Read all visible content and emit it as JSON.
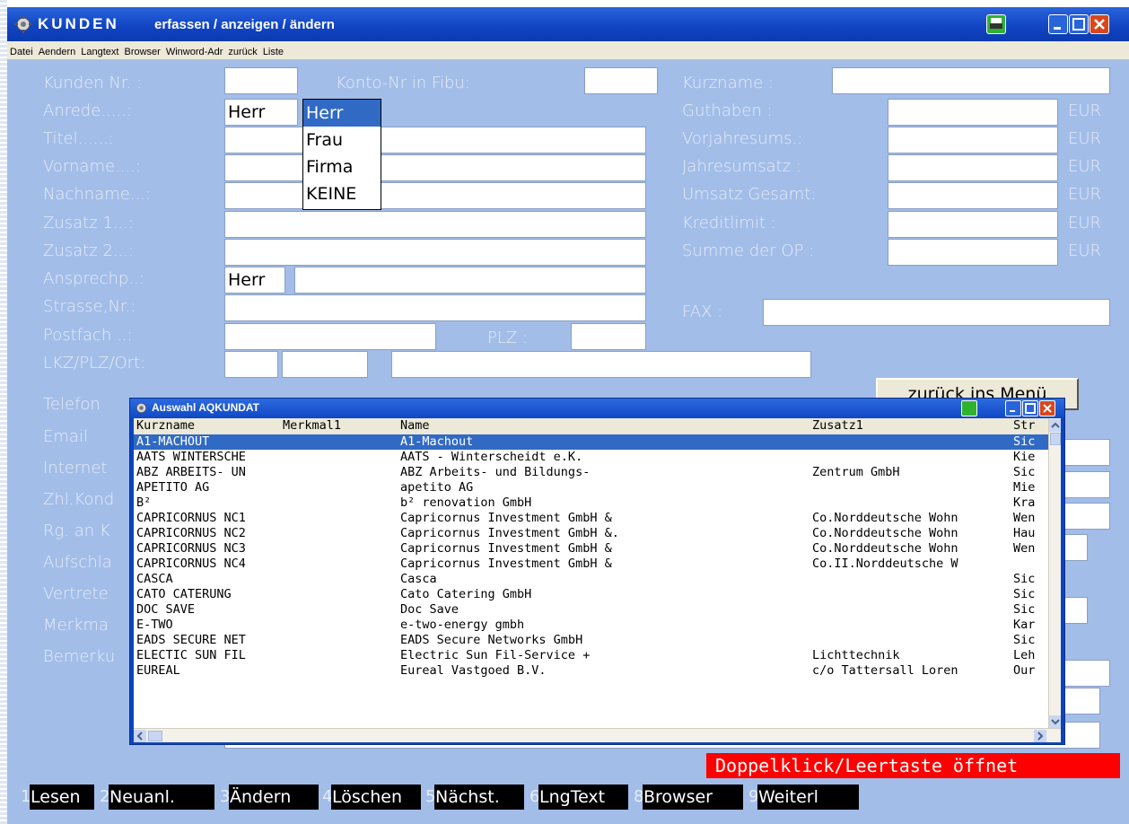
{
  "window": {
    "title": "KUNDEN",
    "subtitle": "erfassen / anzeigen / ändern"
  },
  "menu": [
    "Datei",
    "Aendern",
    "Langtext",
    "Browser",
    "Winword-Adr",
    "zurück",
    "Liste"
  ],
  "form": {
    "kunden_nr": "Kunden Nr. :",
    "konto_nr": "Konto-Nr in Fibu:",
    "kurzname": "Kurzname :",
    "anrede": "Anrede.....:",
    "anrede_value": "Herr",
    "titel": "Titel......:",
    "vorname": "Vorname....:",
    "nachname": "Nachname...:",
    "zusatz1": "Zusatz 1...:",
    "zusatz2": "Zusatz 2...:",
    "ansprechp": "Ansprechp..:",
    "ansprechp_value": "Herr",
    "strasse": "Strasse,Nr.:",
    "postfach": "Postfach ..:",
    "plz": "PLZ :",
    "lkz": "LKZ/PLZ/Ort:",
    "telefon": "Telefon",
    "email": "Email",
    "internet": "Internet",
    "zhl": "Zhl.Kond",
    "rg": "Rg. an K",
    "aufschlag": "Aufschla",
    "vertreter": "Vertrete",
    "merkmal": "Merkma",
    "bemerkung": "Bemerku",
    "guthaben": "Guthaben     :",
    "vorjahr": "Vorjahresums.:",
    "jahresumsatz": "Jahresumsatz :",
    "umsatz_gesamt": "Umsatz Gesamt:",
    "kreditlimit": "Kreditlimit  :",
    "summe_op": "Summe der OP :",
    "fax": "FAX :",
    "currency": "EUR"
  },
  "anrede_options": [
    "Herr",
    "Frau",
    "Firma",
    "KEINE"
  ],
  "back_button": "zurück ins Menü",
  "status_text": "Doppelklick/Leertaste öffnet",
  "function_keys": [
    {
      "num": "1",
      "label": "Lesen"
    },
    {
      "num": "2",
      "label": "Neuanl."
    },
    {
      "num": "3",
      "label": "Ändern"
    },
    {
      "num": "4",
      "label": "Löschen"
    },
    {
      "num": "5",
      "label": "Nächst."
    },
    {
      "num": "6",
      "label": "LngText"
    },
    {
      "num": "8",
      "label": "Browser"
    },
    {
      "num": "9",
      "label": "Weiterl"
    }
  ],
  "popup": {
    "title": "Auswahl AQKUNDAT",
    "columns": [
      "Kurzname",
      "Merkmal1",
      "Name",
      "Zusatz1",
      "Str"
    ],
    "rows": [
      [
        "A1-MACHOUT",
        "",
        "A1-Machout",
        "",
        "Sic"
      ],
      [
        "AATS WINTERSCHE",
        "",
        "AATS - Winterscheidt e.K.",
        "",
        "Kie"
      ],
      [
        "ABZ ARBEITS- UN",
        "",
        "ABZ Arbeits- und Bildungs-",
        "Zentrum GmbH",
        "Sic"
      ],
      [
        "APETITO AG",
        "",
        "apetito AG",
        "",
        "Mie"
      ],
      [
        "B²",
        "",
        "b² renovation GmbH",
        "",
        "Kra"
      ],
      [
        "CAPRICORNUS NC1",
        "",
        "Capricornus Investment GmbH &",
        "Co.Norddeutsche Wohn",
        "Wen"
      ],
      [
        "CAPRICORNUS NC2",
        "",
        "Capricornus Investment GmbH &.",
        "Co.Norddeutsche Wohn",
        "Hau"
      ],
      [
        "CAPRICORNUS NC3",
        "",
        "Capricornus Investment GmbH &",
        "Co.Norddeutsche Wohn",
        "Wen"
      ],
      [
        "CAPRICORNUS NC4",
        "",
        "Capricornus Investment GmbH &",
        "Co.II.Norddeutsche W",
        ""
      ],
      [
        "CASCA",
        "",
        "Casca",
        "",
        "Sic"
      ],
      [
        "CATO CATERUNG",
        "",
        "Cato Catering GmbH",
        "",
        "Sic"
      ],
      [
        "DOC SAVE",
        "",
        "Doc Save",
        "",
        "Sic"
      ],
      [
        "E-TWO",
        "",
        "e-two-energy gmbh",
        "",
        "Kar"
      ],
      [
        "EADS SECURE NET",
        "",
        "EADS Secure Networks GmbH",
        "",
        "Sic"
      ],
      [
        "ELECTIC SUN FIL",
        "",
        "Electric Sun Fil-Service +",
        "Lichttechnik",
        "Leh"
      ],
      [
        "EUREAL",
        "",
        "Eureal Vastgoed B.V.",
        "c/o Tattersall Loren",
        "Our"
      ]
    ]
  },
  "colors": {
    "form_bg": "#a3bde9",
    "label": "#e6ecf6",
    "selection": "#316ac5",
    "status_bg": "#ff0000"
  }
}
